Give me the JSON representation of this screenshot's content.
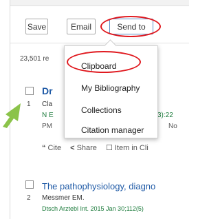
{
  "toolbar": {
    "save_label": "Save",
    "email_label": "Email",
    "send_to_label": "Send to"
  },
  "results": {
    "count_text": "23,501 re"
  },
  "send_to_menu": {
    "items": [
      {
        "label": "Clipboard"
      },
      {
        "label": "My Bibliography"
      },
      {
        "label": "Collections"
      },
      {
        "label": "Citation manager"
      }
    ]
  },
  "result_items": [
    {
      "number": "1",
      "title": "Dr",
      "authors": "Cla",
      "citation_left": "N E",
      "citation_right": "3):22",
      "pmid": "PM",
      "pmid_right": "No"
    },
    {
      "number": "2",
      "title": "The pathophysiology, diagno",
      "authors": "Messmer EM.",
      "citation": "Dtsch Arztebl Int. 2015 Jan 30;112(5)"
    }
  ],
  "actions": {
    "cite_icon": "“",
    "cite_label": "Cite",
    "share_icon": "<",
    "share_label": "Share",
    "clipboard_icon": "☐",
    "clipboard_label": "Item in Cli"
  },
  "colors": {
    "highlight_ring": "#e0191f",
    "title_link": "#1f5aa6",
    "citation_green": "#1a7a3a",
    "arrow_green": "#8bc34a"
  }
}
